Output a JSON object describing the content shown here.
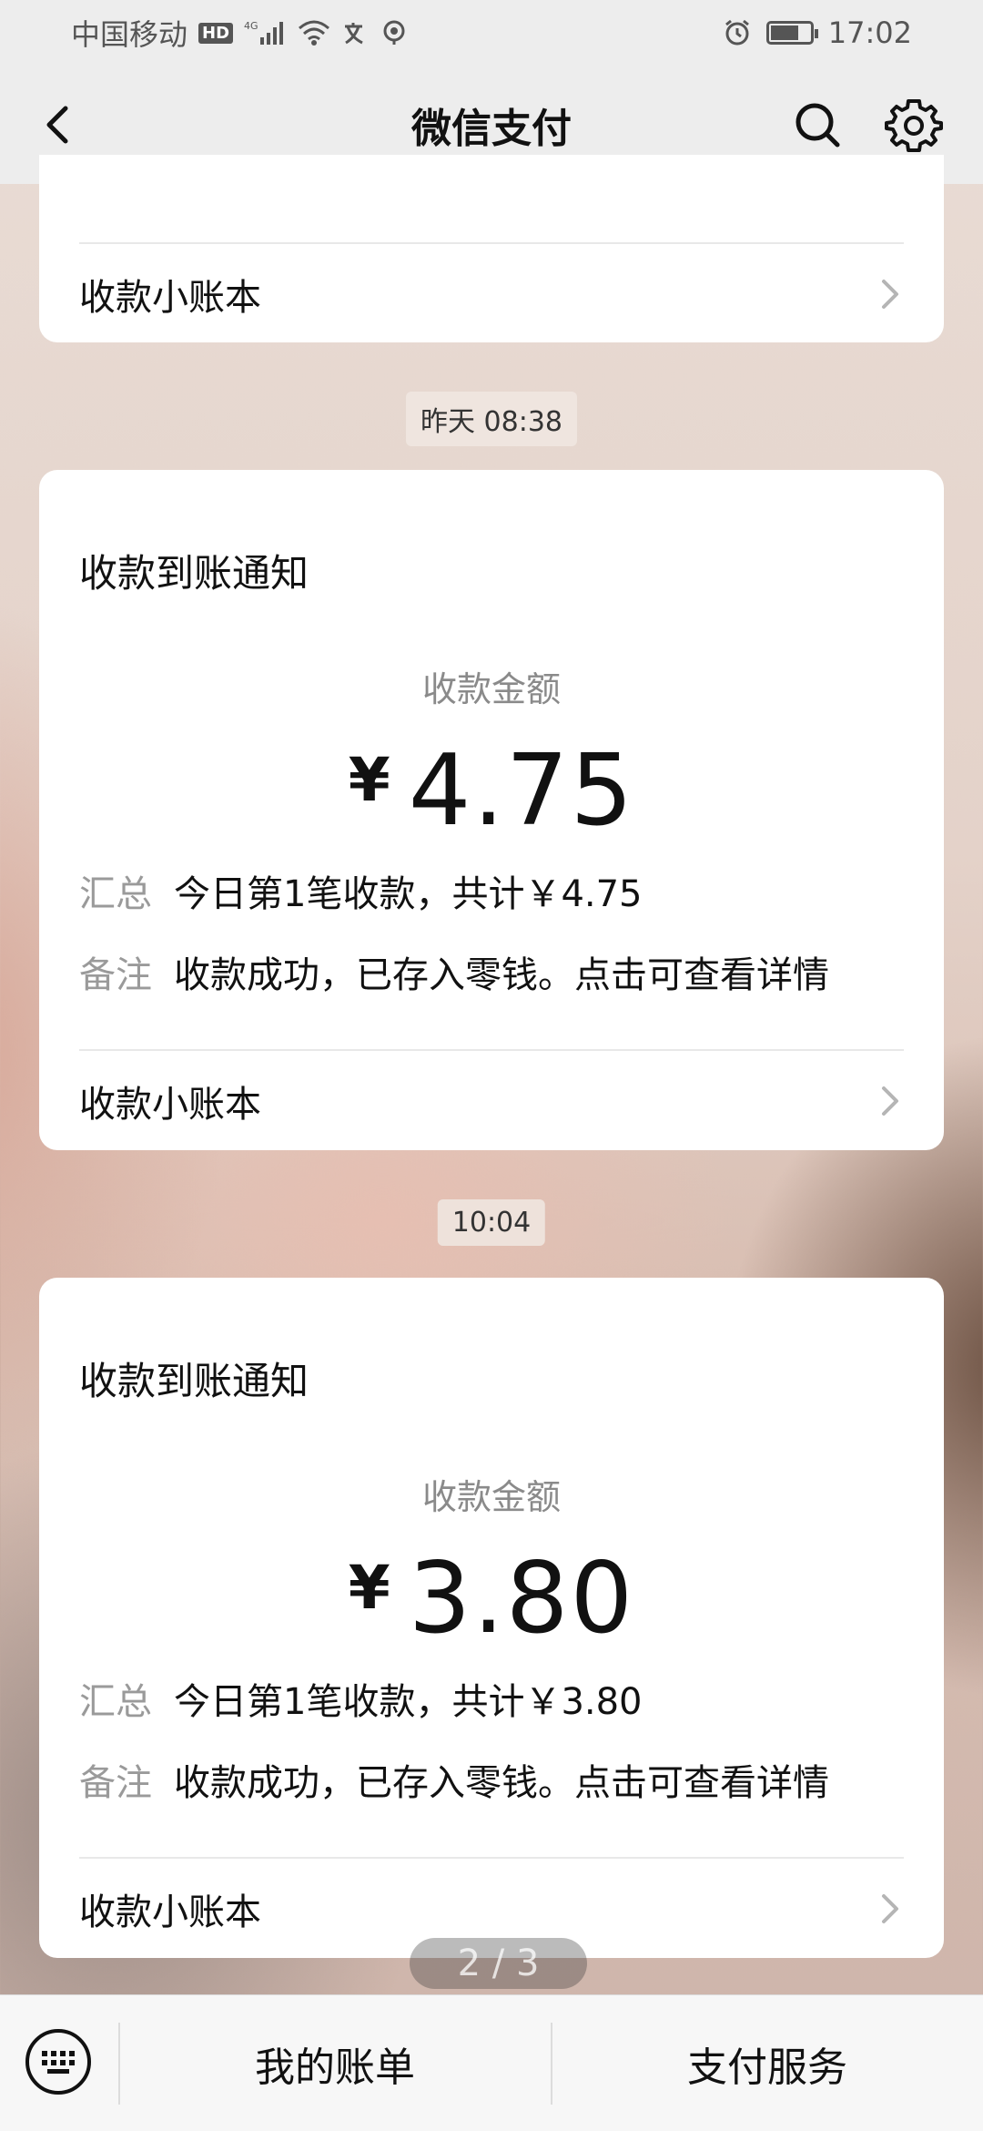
{
  "status_bar": {
    "carrier": "中国移动",
    "hd": "HD",
    "network": "4G",
    "time": "17:02"
  },
  "nav": {
    "title": "微信支付",
    "icons": [
      "back-icon",
      "search-icon",
      "gear-icon"
    ]
  },
  "card_top": {
    "ledger_label": "收款小账本"
  },
  "messages": [
    {
      "time": "昨天 08:38",
      "title": "收款到账通知",
      "amount_label": "收款金额",
      "currency": "¥",
      "amount": "4.75",
      "summary_key": "汇总",
      "summary_value": "今日第1笔收款，共计￥4.75",
      "remark_key": "备注",
      "remark_value": "收款成功，已存入零钱。点击可查看详情",
      "ledger_label": "收款小账本"
    },
    {
      "time": "10:04",
      "title": "收款到账通知",
      "amount_label": "收款金额",
      "currency": "¥",
      "amount": "3.80",
      "summary_key": "汇总",
      "summary_value": "今日第1笔收款，共计￥3.80",
      "remark_key": "备注",
      "remark_value": "收款成功，已存入零钱。点击可查看详情",
      "ledger_label": "收款小账本"
    }
  ],
  "page_indicator": "2 / 3",
  "bottom_bar": {
    "bill": "我的账单",
    "services": "支付服务"
  }
}
